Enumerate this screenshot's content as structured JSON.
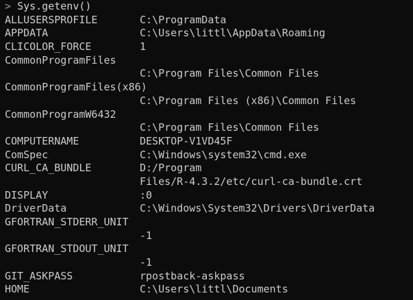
{
  "console": {
    "prompt": ">",
    "command": "Sys.getenv()",
    "rows": [
      {
        "name": "ALLUSERSPROFILE",
        "value": "C:\\ProgramData"
      },
      {
        "name": "APPDATA",
        "value": "C:\\Users\\littl\\AppData\\Roaming"
      },
      {
        "name": "CLICOLOR_FORCE",
        "value": "1"
      },
      {
        "name": "CommonProgramFiles",
        "value": ""
      },
      {
        "name": "",
        "value": "C:\\Program Files\\Common Files"
      },
      {
        "name": "CommonProgramFiles(x86)",
        "value": ""
      },
      {
        "name": "",
        "value": "C:\\Program Files (x86)\\Common Files"
      },
      {
        "name": "CommonProgramW6432",
        "value": ""
      },
      {
        "name": "",
        "value": "C:\\Program Files\\Common Files"
      },
      {
        "name": "COMPUTERNAME",
        "value": "DESKTOP-V1VD45F"
      },
      {
        "name": "ComSpec",
        "value": "C:\\Windows\\system32\\cmd.exe"
      },
      {
        "name": "CURL_CA_BUNDLE",
        "value": "D:/Program"
      },
      {
        "name": "",
        "value": "Files/R-4.3.2/etc/curl-ca-bundle.crt"
      },
      {
        "name": "DISPLAY",
        "value": ":0"
      },
      {
        "name": "DriverData",
        "value": "C:\\Windows\\System32\\Drivers\\DriverData"
      },
      {
        "name": "GFORTRAN_STDERR_UNIT",
        "value": ""
      },
      {
        "name": "",
        "value": "-1"
      },
      {
        "name": "GFORTRAN_STDOUT_UNIT",
        "value": ""
      },
      {
        "name": "",
        "value": "-1"
      },
      {
        "name": "GIT_ASKPASS",
        "value": "rpostback-askpass"
      },
      {
        "name": "HOME",
        "value": "C:\\Users\\littl\\Documents"
      }
    ]
  }
}
